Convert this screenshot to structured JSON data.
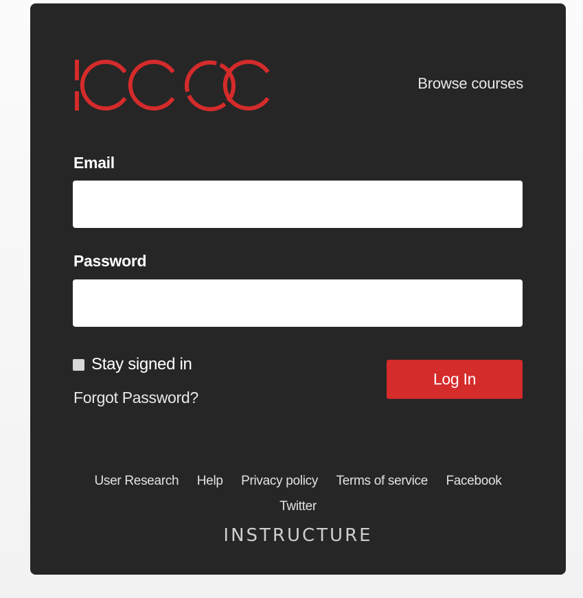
{
  "brand": {
    "logo_text": "ICCOC",
    "accent_color": "#d42b2b"
  },
  "header": {
    "browse_label": "Browse courses"
  },
  "form": {
    "email_label": "Email",
    "email_value": "",
    "password_label": "Password",
    "password_value": "",
    "stay_signed_in_label": "Stay signed in",
    "stay_signed_in_checked": false,
    "forgot_password_label": "Forgot Password?",
    "login_button_label": "Log In"
  },
  "footer": {
    "links": [
      "User Research",
      "Help",
      "Privacy policy",
      "Terms of service",
      "Facebook",
      "Twitter"
    ],
    "vendor": "INSTRUCTURE"
  }
}
